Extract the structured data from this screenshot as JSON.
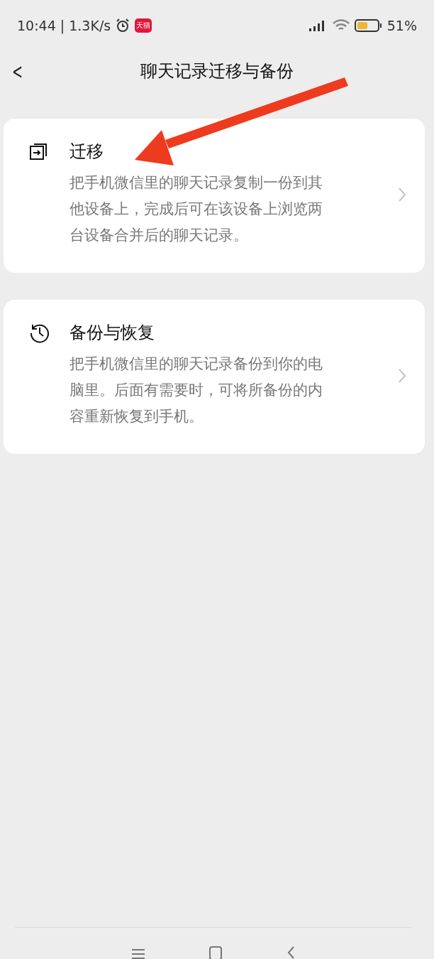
{
  "status_bar": {
    "time": "10:44",
    "speed": "| 1.3K/s",
    "app_badge": "天猫",
    "battery": "51%"
  },
  "header": {
    "back": "<",
    "title": "聊天记录迁移与备份"
  },
  "options": [
    {
      "kind": "migrate",
      "title": "迁移",
      "description": "把手机微信里的聊天记录复制一份到其他设备上，完成后可在该设备上浏览两台设备合并后的聊天记录。"
    },
    {
      "kind": "backup",
      "title": "备份与恢复",
      "description": "把手机微信里的聊天记录备份到你的电脑里。后面有需要时，可将所备份的内容重新恢复到手机。"
    }
  ],
  "annotation": {
    "kind": "arrow",
    "color": "#ee3a1e"
  }
}
